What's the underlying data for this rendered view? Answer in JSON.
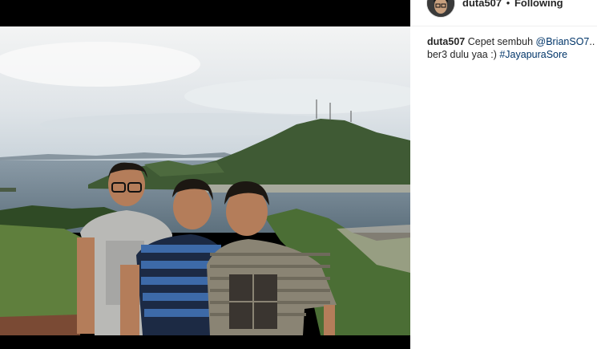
{
  "post": {
    "username": "duta507",
    "separator": "•",
    "follow_status": "Following"
  },
  "caption": {
    "username": "duta507",
    "text_before": " Cepet sembuh ",
    "mention": "@BrianSO7",
    "text_after": ".. Ph",
    "line2_text": "ber3 dulu yaa :) ",
    "hashtag": "#JayapuraSore"
  },
  "colors": {
    "link": "#003569",
    "text": "#262626",
    "divider": "#efefef",
    "photo_letterbox": "#000000"
  }
}
